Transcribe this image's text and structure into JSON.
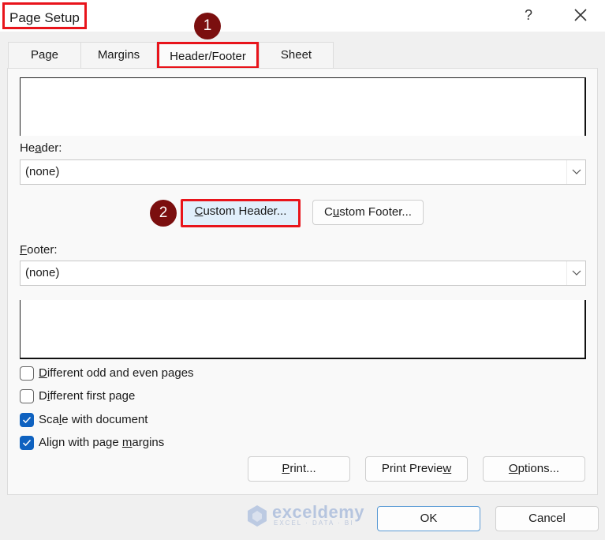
{
  "window": {
    "title": "Page Setup",
    "help_label": "?",
    "close_icon": "close-icon"
  },
  "tabs": [
    {
      "label": "Page",
      "active": false
    },
    {
      "label": "Margins",
      "active": false
    },
    {
      "label": "Header/Footer",
      "active": true
    },
    {
      "label": "Sheet",
      "active": false
    }
  ],
  "header": {
    "label_pre": "He",
    "label_u": "a",
    "label_post": "der:",
    "value": "(none)"
  },
  "footer": {
    "label_u": "F",
    "label_post": "ooter:",
    "value": "(none)"
  },
  "custom_buttons": {
    "custom_header": {
      "u": "C",
      "rest": "ustom Header..."
    },
    "custom_footer": {
      "pre": "C",
      "u": "u",
      "rest": "stom Footer..."
    }
  },
  "checkboxes": [
    {
      "pre": "",
      "u": "D",
      "post": "ifferent odd and even pages",
      "checked": false
    },
    {
      "pre": "D",
      "u": "i",
      "post": "fferent first page",
      "checked": false
    },
    {
      "pre": "Sca",
      "u": "l",
      "post": "e with document",
      "checked": true
    },
    {
      "pre": "Align with page ",
      "u": "m",
      "post": "argins",
      "checked": true
    }
  ],
  "action_buttons": {
    "print": {
      "pre": "",
      "u": "P",
      "post": "rint..."
    },
    "print_preview": {
      "pre": "Print Previe",
      "u": "w",
      "post": ""
    },
    "options": {
      "pre": "",
      "u": "O",
      "post": "ptions..."
    }
  },
  "dialog_buttons": {
    "ok": "OK",
    "cancel": "Cancel"
  },
  "annotations": {
    "step1": "1",
    "step2": "2",
    "highlight_color": "#e8141b",
    "badge_color": "#7b0f0f"
  },
  "watermark": {
    "brand": "exceldemy",
    "tagline": "EXCEL · DATA · BI"
  },
  "colors": {
    "checkbox_checked": "#0f62c0",
    "focused_button_bg": "#e1effb"
  }
}
